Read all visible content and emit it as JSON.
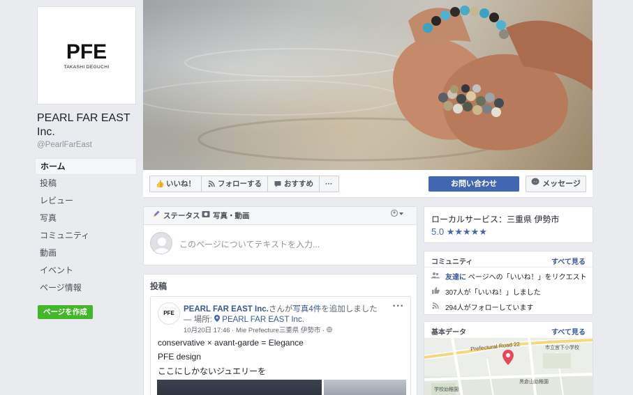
{
  "sidebar": {
    "logo_text": "PFE",
    "logo_sub": "TAKASHI DEGUCHI",
    "page_name": "PEARL FAR EAST Inc.",
    "handle": "@PearlFarEast",
    "nav": [
      {
        "label": "ホーム",
        "active": true
      },
      {
        "label": "投稿"
      },
      {
        "label": "レビュー"
      },
      {
        "label": "写真"
      },
      {
        "label": "コミュニティ"
      },
      {
        "label": "動画"
      },
      {
        "label": "イベント"
      },
      {
        "label": "ページ情報"
      }
    ],
    "create_page": "ページを作成"
  },
  "actions": {
    "like": "いいね！",
    "follow": "フォローする",
    "recommend": "おすすめ",
    "more": "···",
    "contact": "お問い合わせ",
    "message": "メッセージ"
  },
  "composer": {
    "status_tab": "ステータス",
    "photo_tab": "写真・動画",
    "placeholder": "このページについてテキストを入力..."
  },
  "posts": {
    "title": "投稿",
    "author": "PEARL FAR EAST Inc.",
    "action_text": "さんが",
    "action_link": "写真4件",
    "action_tail": "を追加しました",
    "location_prefix": "— 場所:",
    "location": "PEARL FAR EAST Inc.",
    "meta": "10月20日 17:46 · Mie Prefecture三重県 伊勢市 ·",
    "avatar_text": "PFE",
    "body": [
      "conservative × avant-garde = Elegance",
      "PFE design",
      "ここにしかないジュエリーを"
    ],
    "more": "···"
  },
  "right": {
    "local_title": "ローカルサービス：三重県 伊勢市",
    "rating": "5.0",
    "stars": "★★★★★",
    "community": {
      "title": "コミュニティ",
      "see_all": "すべて見る",
      "invite_link": "友達に",
      "invite_text": "ページへの「いいね！」をリクエスト",
      "likes": "307人が「いいね！」しました",
      "follows": "294人がフォローしています"
    },
    "about": {
      "title": "基本データ",
      "see_all": "すべて見る",
      "map_road": "Prefectural Road 22",
      "map_label1": "市立宮下小学校",
      "map_label2": "黒倉山幼稚園",
      "map_label3": "学校幼稚園"
    }
  },
  "colors": {
    "brand_blue": "#4267b2",
    "link_blue": "#365899",
    "green": "#42b72a",
    "background": "#e9ebee"
  }
}
